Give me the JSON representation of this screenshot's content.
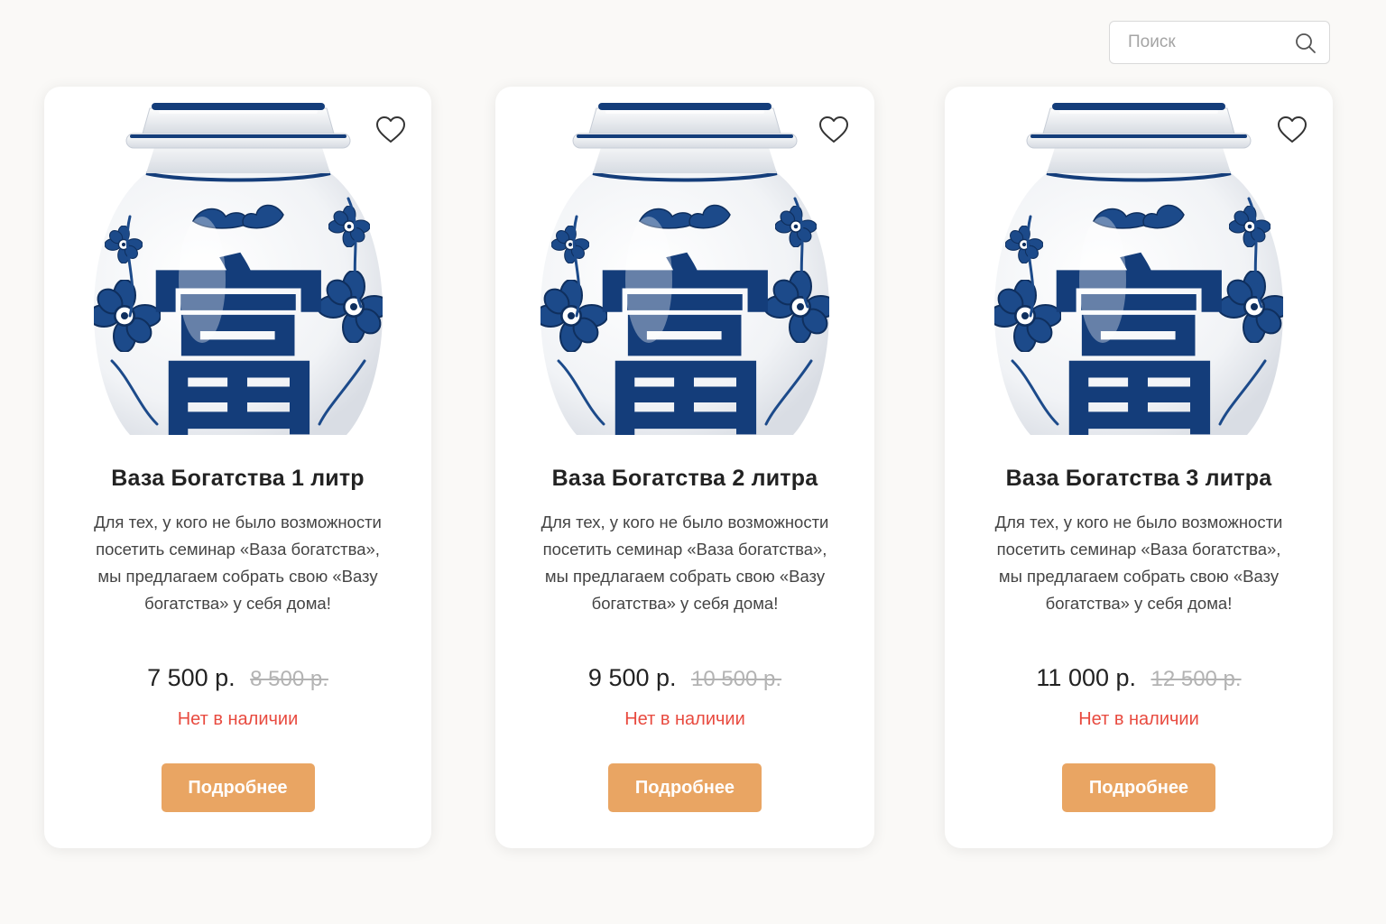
{
  "search": {
    "placeholder": "Поиск",
    "icon": "search-icon"
  },
  "colors": {
    "accent": "#e9a563",
    "out_of_stock": "#e84a3f",
    "old_price": "#b3b3b3",
    "porcelain_blue": "#143d7a"
  },
  "products": [
    {
      "title": "Ваза Богатства 1 литр",
      "description": "Для тех, у кого не было возможности посетить семинар «Ваза богатства», мы предлагаем собрать свою «Вазу богатства» у себя дома!",
      "price": "7 500 р.",
      "old_price": "8 500 р.",
      "status": "Нет в наличии",
      "button": "Подробнее",
      "favorite_icon": "heart-icon"
    },
    {
      "title": "Ваза Богатства 2 литра",
      "description": "Для тех, у кого не было возможности посетить семинар «Ваза богатства», мы предлагаем собрать свою «Вазу богатства» у себя дома!",
      "price": "9 500 р.",
      "old_price": "10 500 р.",
      "status": "Нет в наличии",
      "button": "Подробнее",
      "favorite_icon": "heart-icon"
    },
    {
      "title": "Ваза Богатства 3 литра",
      "description": "Для тех, у кого не было возможности посетить семинар «Ваза богатства», мы предлагаем собрать свою «Вазу богатства» у себя дома!",
      "price": "11 000 р.",
      "old_price": "12 500 р.",
      "status": "Нет в наличии",
      "button": "Подробнее",
      "favorite_icon": "heart-icon"
    }
  ],
  "vase_glyph": "富"
}
